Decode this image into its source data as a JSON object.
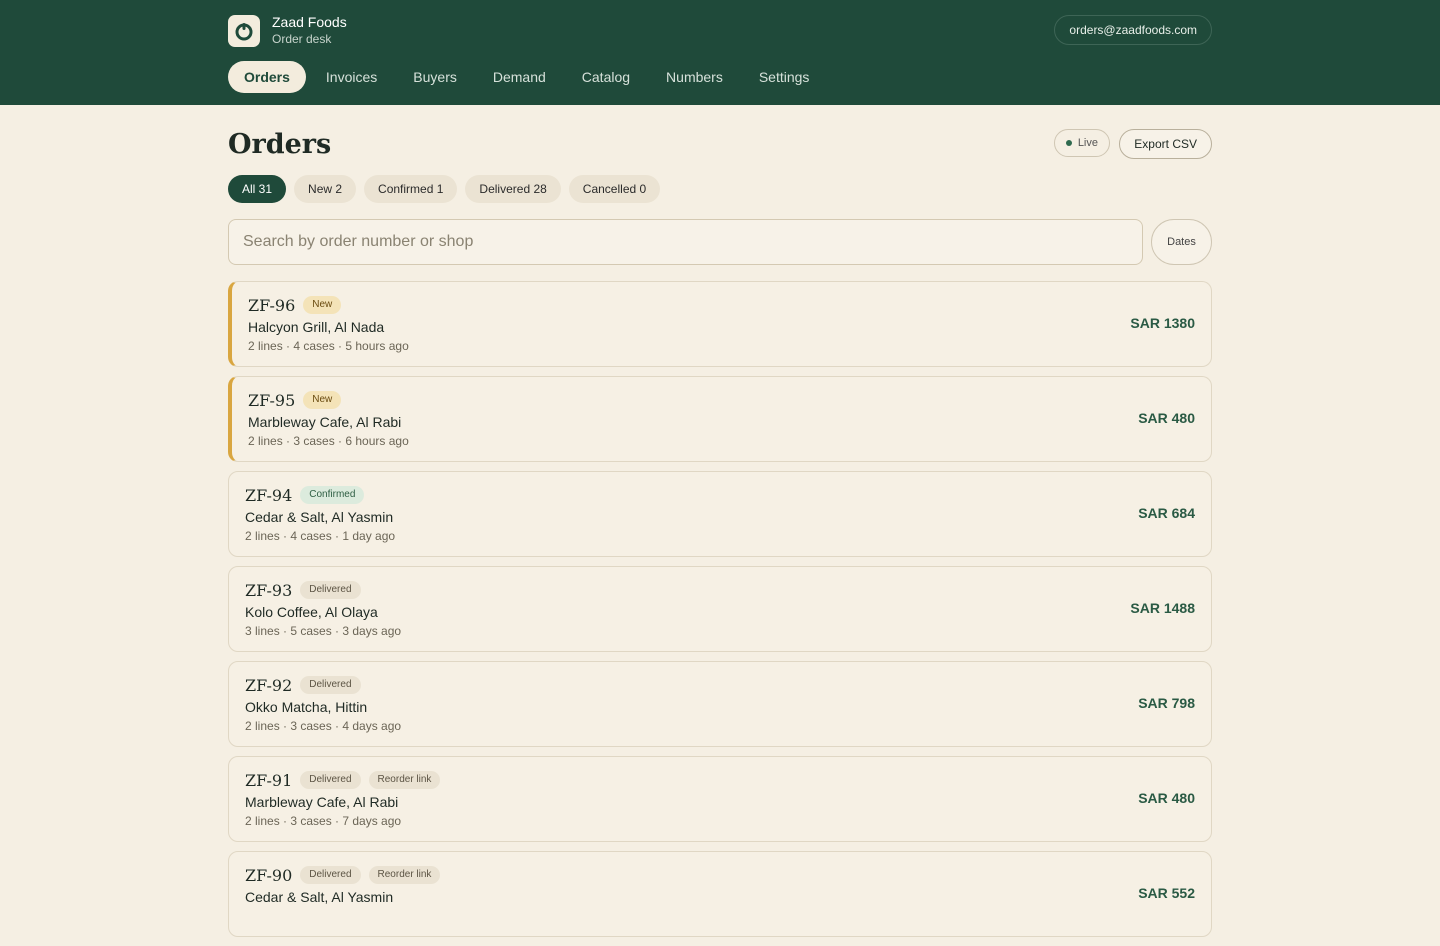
{
  "brand": {
    "name": "Zaad Foods",
    "subtitle": "Order desk"
  },
  "account": {
    "email": "orders@zaadfoods.com"
  },
  "nav": {
    "items": [
      {
        "label": "Orders",
        "active": true
      },
      {
        "label": "Invoices"
      },
      {
        "label": "Buyers"
      },
      {
        "label": "Demand"
      },
      {
        "label": "Catalog"
      },
      {
        "label": "Numbers"
      },
      {
        "label": "Settings"
      }
    ]
  },
  "page": {
    "title": "Orders",
    "live_label": "Live",
    "export_label": "Export CSV"
  },
  "filters": [
    {
      "label": "All 31",
      "active": true
    },
    {
      "label": "New 2"
    },
    {
      "label": "Confirmed 1"
    },
    {
      "label": "Delivered 28"
    },
    {
      "label": "Cancelled 0"
    }
  ],
  "search": {
    "placeholder": "Search by order number or shop",
    "dates_label": "Dates"
  },
  "orders": [
    {
      "id": "ZF-96",
      "status": "New",
      "shop": "Halcyon Grill, Al Nada",
      "meta": "2 lines · 4 cases · 5 hours ago",
      "amount": "SAR 1380"
    },
    {
      "id": "ZF-95",
      "status": "New",
      "shop": "Marbleway Cafe, Al Rabi",
      "meta": "2 lines · 3 cases · 6 hours ago",
      "amount": "SAR 480"
    },
    {
      "id": "ZF-94",
      "status": "Confirmed",
      "shop": "Cedar & Salt, Al Yasmin",
      "meta": "2 lines · 4 cases · 1 day ago",
      "amount": "SAR 684"
    },
    {
      "id": "ZF-93",
      "status": "Delivered",
      "shop": "Kolo Coffee, Al Olaya",
      "meta": "3 lines · 5 cases · 3 days ago",
      "amount": "SAR 1488"
    },
    {
      "id": "ZF-92",
      "status": "Delivered",
      "shop": "Okko Matcha, Hittin",
      "meta": "2 lines · 3 cases · 4 days ago",
      "amount": "SAR 798"
    },
    {
      "id": "ZF-91",
      "status": "Delivered",
      "extra_tag": "Reorder link",
      "shop": "Marbleway Cafe, Al Rabi",
      "meta": "2 lines · 3 cases · 7 days ago",
      "amount": "SAR 480"
    },
    {
      "id": "ZF-90",
      "status": "Delivered",
      "extra_tag": "Reorder link",
      "shop": "Cedar & Salt, Al Yasmin",
      "meta": "",
      "amount": "SAR 552"
    }
  ],
  "colors": {
    "header_bg": "#1f4a3a",
    "page_bg": "#f5efe3",
    "new_accent": "#d9a640",
    "amount": "#2a5a44"
  },
  "icons": {
    "logo": "seed-ring-icon",
    "live": "live-dot-icon"
  }
}
